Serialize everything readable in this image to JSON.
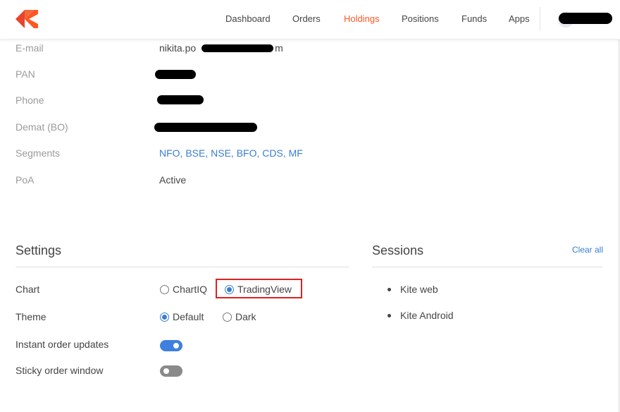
{
  "header": {
    "logo": "kite-logo",
    "nav": [
      {
        "label": "Dashboard",
        "active": false
      },
      {
        "label": "Orders",
        "active": false
      },
      {
        "label": "Holdings",
        "active": true
      },
      {
        "label": "Positions",
        "active": false
      },
      {
        "label": "Funds",
        "active": false
      },
      {
        "label": "Apps",
        "active": false
      }
    ],
    "accent_color": "#ff5722"
  },
  "profile": {
    "email_label": "E-mail",
    "email_value": "nikita.po",
    "email_suffix": "m",
    "pan_label": "PAN",
    "phone_label": "Phone",
    "demat_label": "Demat (BO)",
    "segments_label": "Segments",
    "segments_value": "NFO, BSE, NSE, BFO, CDS, MF",
    "poa_label": "PoA",
    "poa_value": "Active"
  },
  "settings": {
    "title": "Settings",
    "chart_label": "Chart",
    "chart_options": [
      "ChartIQ",
      "TradingView"
    ],
    "chart_selected": "TradingView",
    "theme_label": "Theme",
    "theme_options": [
      "Default",
      "Dark"
    ],
    "theme_selected": "Default",
    "instant_label": "Instant order updates",
    "instant_on": true,
    "sticky_label": "Sticky order window",
    "sticky_on": false
  },
  "sessions": {
    "title": "Sessions",
    "clear_label": "Clear all",
    "items": [
      "Kite web",
      "Kite Android"
    ]
  },
  "colors": {
    "link": "#387ed1",
    "highlight_box": "#e02020"
  }
}
